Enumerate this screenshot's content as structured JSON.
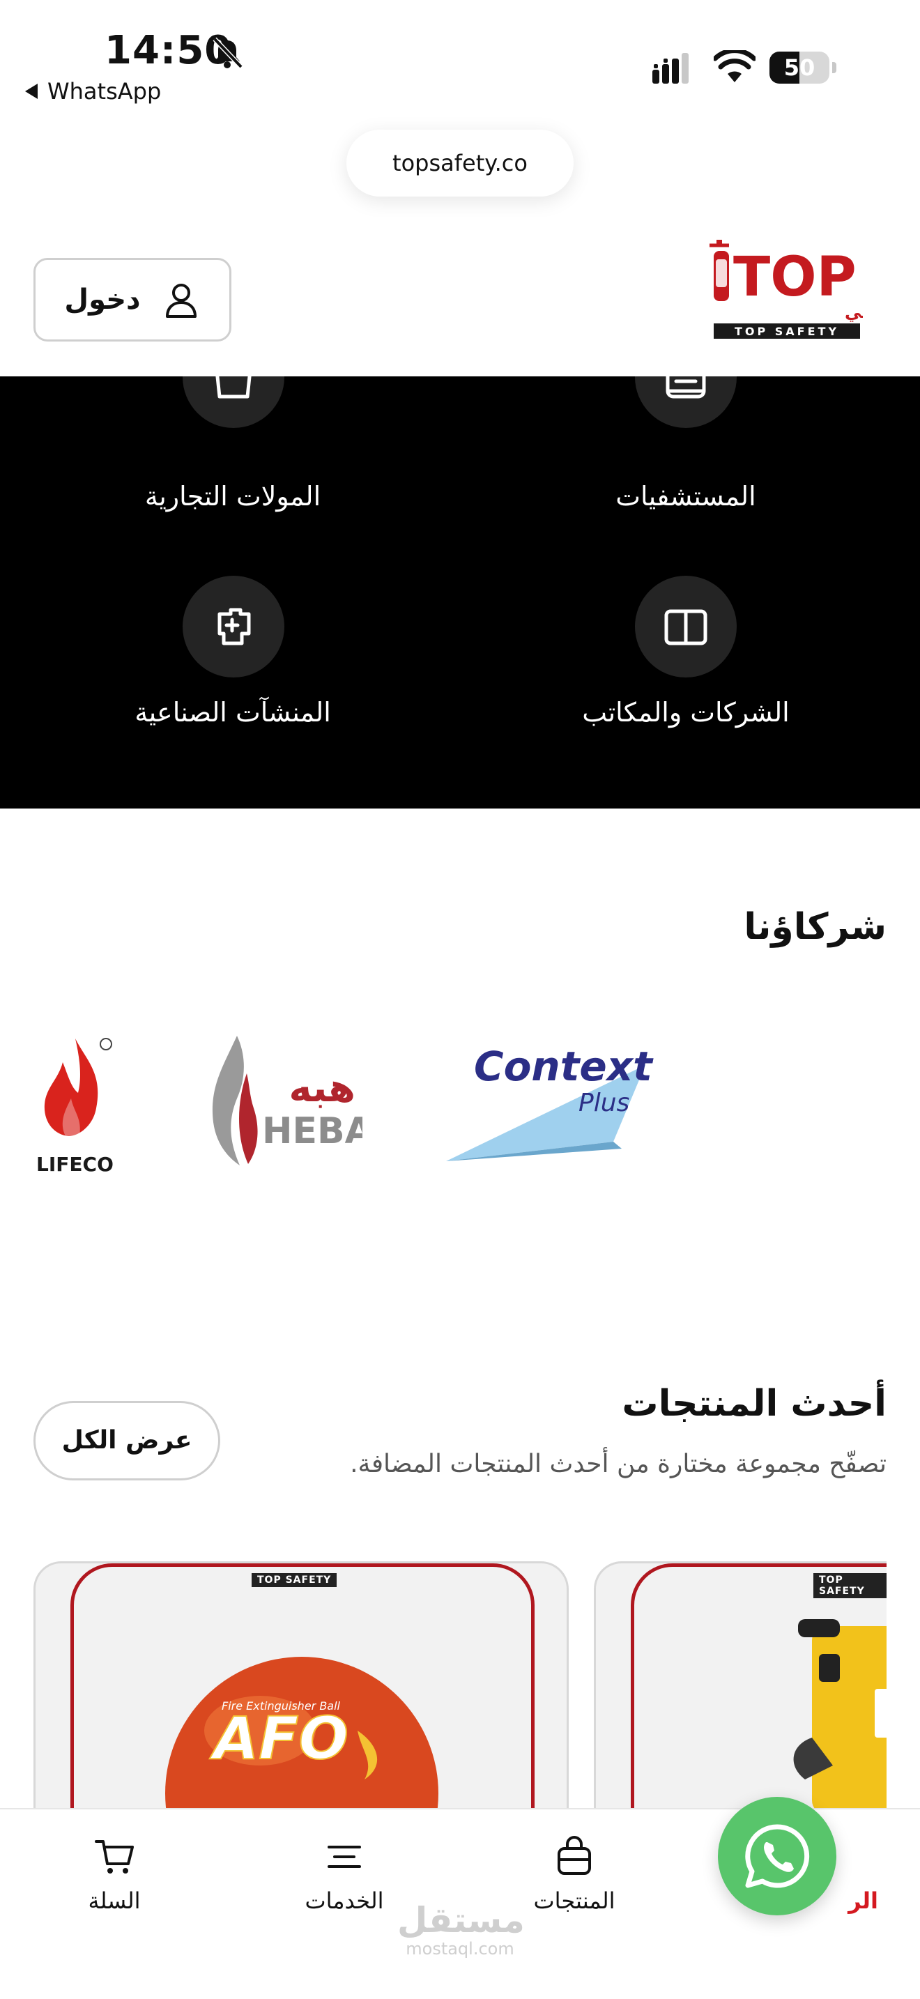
{
  "status_bar": {
    "time": "14:50",
    "back_app": "WhatsApp",
    "battery_level": 50,
    "battery_text": "50"
  },
  "browser": {
    "url": "topsafety.co"
  },
  "header": {
    "login_label": "دخول",
    "logo": {
      "brand_en": "TOP",
      "brand_ar": "تـوب سيفتـي",
      "tagline": "TOP SAFETY"
    }
  },
  "sectors": [
    {
      "label": "المستشفيات",
      "icon": "hospital-icon"
    },
    {
      "label": "المولات التجارية",
      "icon": "shopping-bag-icon"
    },
    {
      "label": "الشركات والمكاتب",
      "icon": "book-icon"
    },
    {
      "label": "المنشآت الصناعية",
      "icon": "industry-icon"
    }
  ],
  "partners": {
    "title": "شركاؤنا",
    "logos": [
      {
        "name": "LIFECO",
        "text": "LIFECO"
      },
      {
        "name": "HEBA",
        "text_en": "HEBA",
        "text_ar": "هبه"
      },
      {
        "name": "Context Plus",
        "text": "Context",
        "sub": "Plus"
      }
    ]
  },
  "latest": {
    "title": "أحدث المنتجات",
    "subtitle": "تصفّح مجموعة مختارة من أحدث المنتجات المضافة.",
    "view_all": "عرض الكل",
    "cards": [
      {
        "brand": "TOP SAFETY",
        "product_text": "AFO",
        "product_sub": "Fire Extinguisher Ball"
      },
      {
        "brand": "TOP SAFETY"
      }
    ]
  },
  "bottom_nav": {
    "items": [
      {
        "label": "السلة",
        "icon": "cart-icon"
      },
      {
        "label": "الخدمات",
        "icon": "menu-icon"
      },
      {
        "label": "المنتجات",
        "icon": "products-bag-icon"
      },
      {
        "label": "الر",
        "icon": "home-icon",
        "active": true
      }
    ]
  },
  "watermark": {
    "main": "مستقل",
    "sub": "mostaql.com"
  },
  "colors": {
    "brand_red": "#d41920",
    "whatsapp_green": "#58c56b",
    "sector_bg": "#000000"
  }
}
